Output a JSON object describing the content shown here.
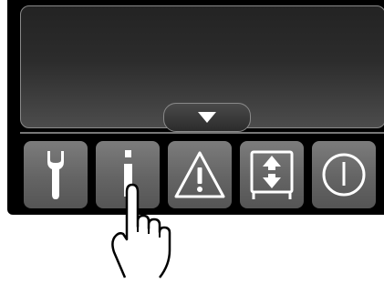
{
  "toolbar": {
    "buttons": [
      {
        "name": "service",
        "icon": "wrench-icon"
      },
      {
        "name": "info",
        "icon": "info-icon"
      },
      {
        "name": "warning",
        "icon": "warning-icon"
      },
      {
        "name": "transfer",
        "icon": "transfer-icon"
      },
      {
        "name": "power",
        "icon": "power-icon"
      }
    ]
  },
  "screen": {
    "expand_tab_icon": "triangle-down-icon"
  },
  "pointer": {
    "icon": "hand-pointer-icon",
    "target": "info"
  },
  "colors": {
    "panel": "#000000",
    "button": "#6a6a6a",
    "icon": "#ffffff"
  }
}
